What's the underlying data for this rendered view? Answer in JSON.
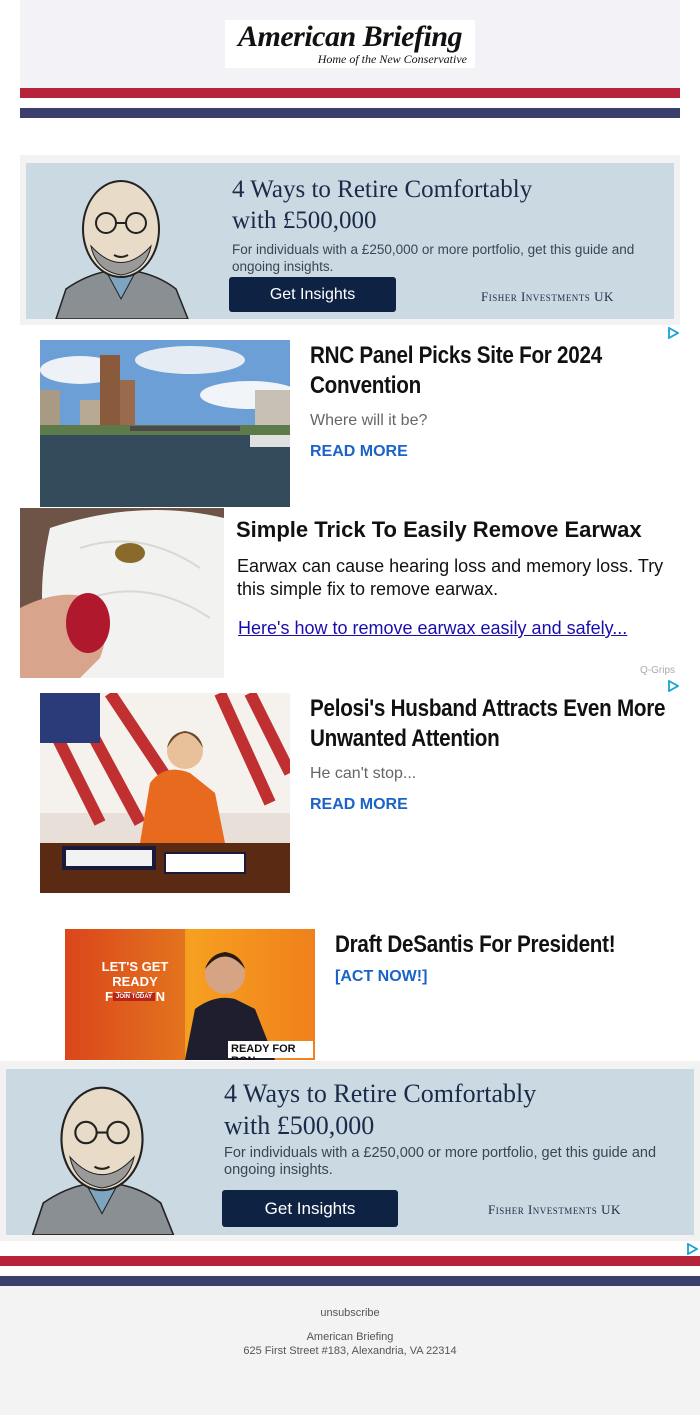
{
  "header": {
    "logo_title": "American Briefing",
    "logo_subtitle": "Home of the New Conservative",
    "colors": {
      "red": "#b5243a",
      "blue": "#3c3f6e"
    }
  },
  "fisher_ad_top": {
    "headline_line1": "4 Ways to Retire Comfortably",
    "headline_line2": "with £500,000",
    "body": "For individuals with a £250,000 or more portfolio, get this guide and ongoing insights.",
    "button": "Get Insights",
    "brand": "Fisher Investments UK"
  },
  "articles": [
    {
      "title": "RNC Panel Picks Site For 2024 Convention",
      "desc": "Where will it be?",
      "link": "READ MORE",
      "image": "city-river-photo"
    },
    {
      "title": "Pelosi's Husband Attracts Even More Unwanted Attention",
      "desc": "He can't stop...",
      "link": "READ MORE",
      "image": "pelosi-signing-photo"
    }
  ],
  "earwax_ad": {
    "title": "Simple Trick To Easily Remove Earwax",
    "body": "Earwax can cause hearing loss and memory loss. Try this simple fix to remove earwax.",
    "link": "Here's how to remove earwax easily and safely...",
    "brand": "Q-Grips"
  },
  "desantis": {
    "title": "Draft DeSantis For President!",
    "link": "[ACT NOW!]",
    "banner_line1": "LET'S GET READY",
    "banner_line2": "FOR RON",
    "banner_join": "JOIN TODAY",
    "banner_tag": "READY FOR RON"
  },
  "fisher_ad_bottom": {
    "headline_line1": "4 Ways to Retire Comfortably",
    "headline_line2": "with £500,000",
    "body": "For individuals with a £250,000 or more portfolio, get this guide and ongoing insights.",
    "button": "Get Insights",
    "brand": "Fisher Investments UK"
  },
  "footer": {
    "unsubscribe": "unsubscribe",
    "org": "American Briefing",
    "address": "625 First Street #183, Alexandria, VA 22314"
  }
}
